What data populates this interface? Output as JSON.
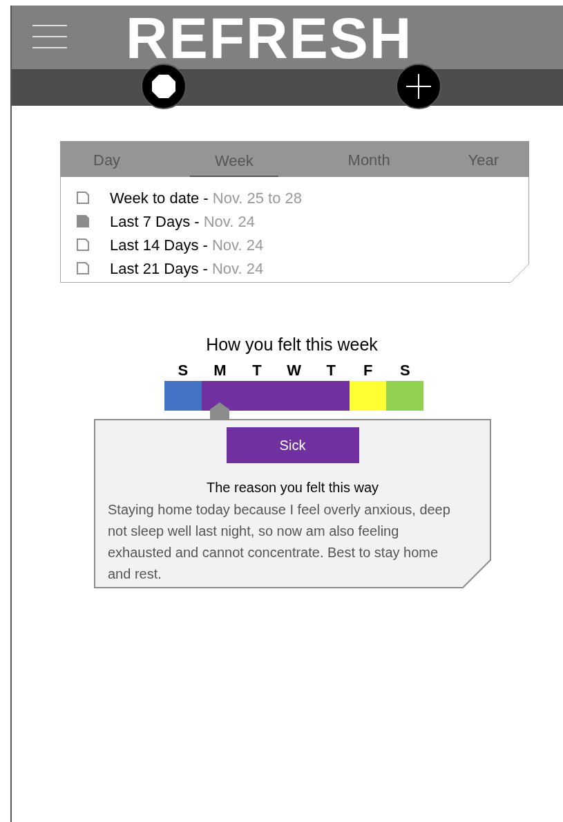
{
  "header": {
    "title": "REFRESH"
  },
  "tabs": [
    {
      "label": "Day",
      "selected": false
    },
    {
      "label": "Week",
      "selected": true
    },
    {
      "label": "Month",
      "selected": false
    },
    {
      "label": "Year",
      "selected": false
    }
  ],
  "ranges": [
    {
      "label": "Week to date - ",
      "date": "Nov. 25 to 28",
      "checked": false
    },
    {
      "label": "Last 7 Days - ",
      "date": "Nov. 24",
      "checked": true
    },
    {
      "label": "Last 14 Days - ",
      "date": "Nov. 24",
      "checked": false
    },
    {
      "label": "Last 21 Days - ",
      "date": "Nov. 24",
      "checked": false
    }
  ],
  "mood": {
    "title": "How you felt this week",
    "days": [
      {
        "letter": "S",
        "color": "#4472c4",
        "selected": false
      },
      {
        "letter": "M",
        "color": "#7030a0",
        "selected": true
      },
      {
        "letter": "T",
        "color": "#7030a0",
        "selected": false
      },
      {
        "letter": "W",
        "color": "#7030a0",
        "selected": false
      },
      {
        "letter": "T",
        "color": "#7030a0",
        "selected": false
      },
      {
        "letter": "F",
        "color": "#ffff33",
        "selected": false
      },
      {
        "letter": "S",
        "color": "#92d050",
        "selected": false
      }
    ],
    "detail": {
      "feeling": "Sick",
      "reason_title": "The reason you felt this way",
      "reason": "Staying home today because I feel overly anxious, deep not sleep well last night, so now am also feeling exhausted and cannot concentrate.  Best to stay home and rest."
    }
  }
}
